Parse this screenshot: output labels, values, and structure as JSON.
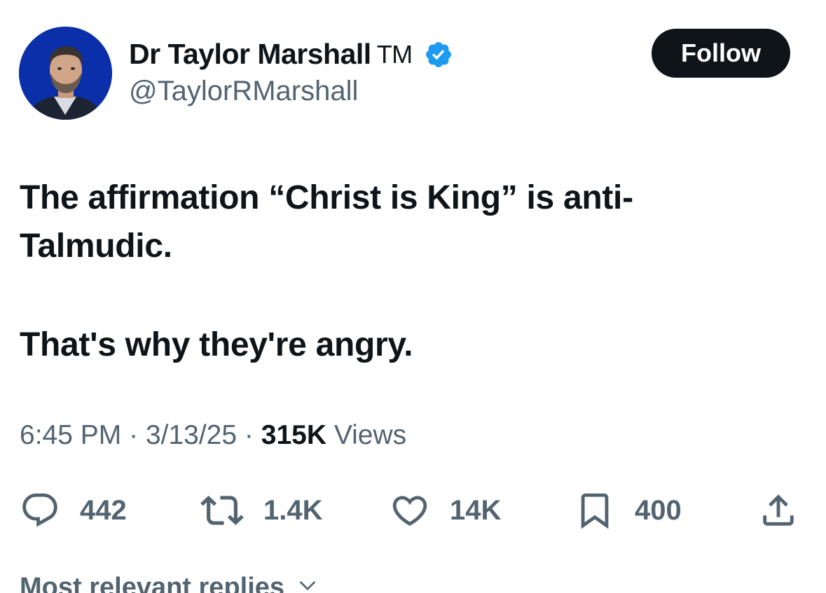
{
  "author": {
    "display_name": "Dr Taylor Marshall",
    "name_suffix": "TM",
    "handle": "@TaylorRMarshall",
    "verified_color": "#1d9bf0"
  },
  "follow_button": {
    "label": "Follow"
  },
  "tweet": {
    "line1": "The affirmation “Christ is King” is anti-",
    "line2": "Talmudic.",
    "line3": "That's why they're angry."
  },
  "meta": {
    "time": "6:45 PM",
    "separator": "·",
    "date": "3/13/25",
    "views_count": "315K",
    "views_label": "Views"
  },
  "actions": {
    "replies": "442",
    "reposts": "1.4K",
    "likes": "14K",
    "bookmarks": "400"
  },
  "replies_sort": {
    "label": "Most relevant replies",
    "icon": "chevron-down-icon"
  },
  "colors": {
    "text": "#0f1419",
    "secondary": "#536471",
    "button_bg": "#0f1419",
    "avatar_bg": "#0b2fa8"
  }
}
